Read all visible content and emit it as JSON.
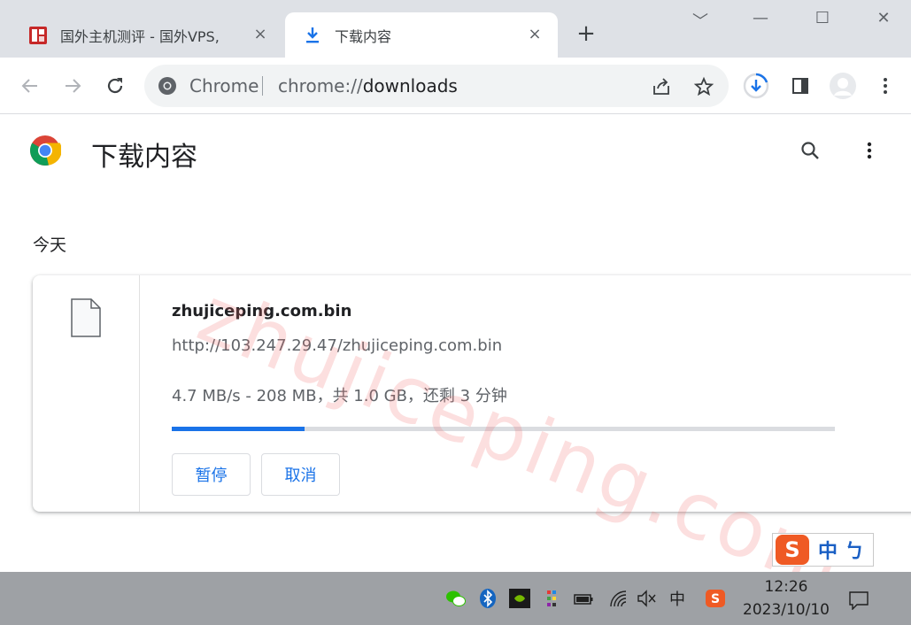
{
  "tabs": [
    {
      "title": "国外主机测评 - 国外VPS,",
      "close": "×",
      "favicon": "site-logo-icon"
    },
    {
      "title": "下载内容",
      "close": "×",
      "favicon": "download-icon"
    }
  ],
  "new_tab": "+",
  "window_controls": {
    "search_tabs": "﹀",
    "minimize": "—",
    "maximize": "☐",
    "close": "✕"
  },
  "omnibox": {
    "site_chip": "Chrome",
    "url_scheme": "chrome://",
    "url_path": "downloads"
  },
  "page": {
    "title": "下载内容"
  },
  "date_label": "今天",
  "download": {
    "filename": "zhujiceping.com.bin",
    "url": "http://103.247.29.47/zhujiceping.com.bin",
    "status": "4.7 MB/s - 208 MB，共 1.0 GB，还剩 3 分钟",
    "progress_fraction": 0.2,
    "pause_label": "暂停",
    "cancel_label": "取消"
  },
  "watermark": "zhujiceping.com",
  "ime": {
    "logo": "S",
    "lang": "中",
    "punct": "ㄅ"
  },
  "taskbar": {
    "ime_lang": "中",
    "time": "12:26",
    "date": "2023/10/10"
  },
  "colors": {
    "accent": "#1a73e8",
    "tabstrip": "#dee1e6",
    "taskbar": "#9ea1a5"
  }
}
